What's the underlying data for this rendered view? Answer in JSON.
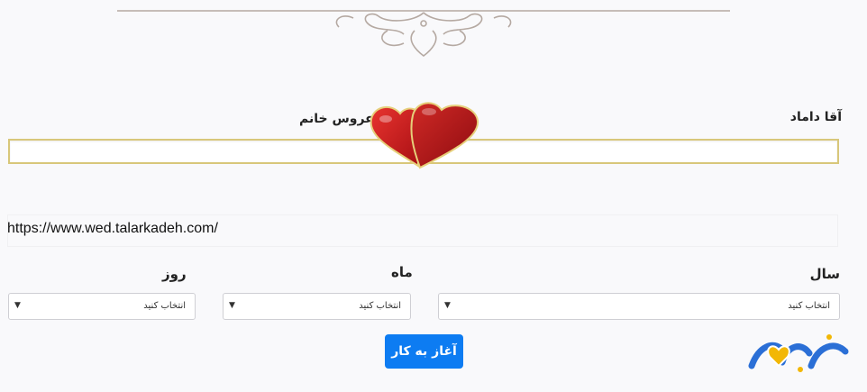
{
  "form": {
    "groom_label": "آقا داماد",
    "bride_label": "عروس خانم",
    "groom_value": "",
    "bride_value": ""
  },
  "url": {
    "text": "https://www.wed.talarkadeh.com/"
  },
  "date": {
    "year_label": "سال",
    "month_label": "ماه",
    "day_label": "روز",
    "year_selected": "انتخاب کنید",
    "month_selected": "انتخاب کنید",
    "day_selected": "انتخاب کنید"
  },
  "actions": {
    "start_label": "آغاز به کار"
  },
  "colors": {
    "primary_button": "#0d7cf2",
    "input_border": "#d8c77a",
    "heart_red": "#c8161d",
    "ornament": "#b5a9a2"
  },
  "icons": {
    "ornament": "decorative-flourish-icon",
    "hearts": "two-hearts-icon",
    "select_arrow": "caret-down-icon",
    "logo": "talarkadeh-logo"
  }
}
